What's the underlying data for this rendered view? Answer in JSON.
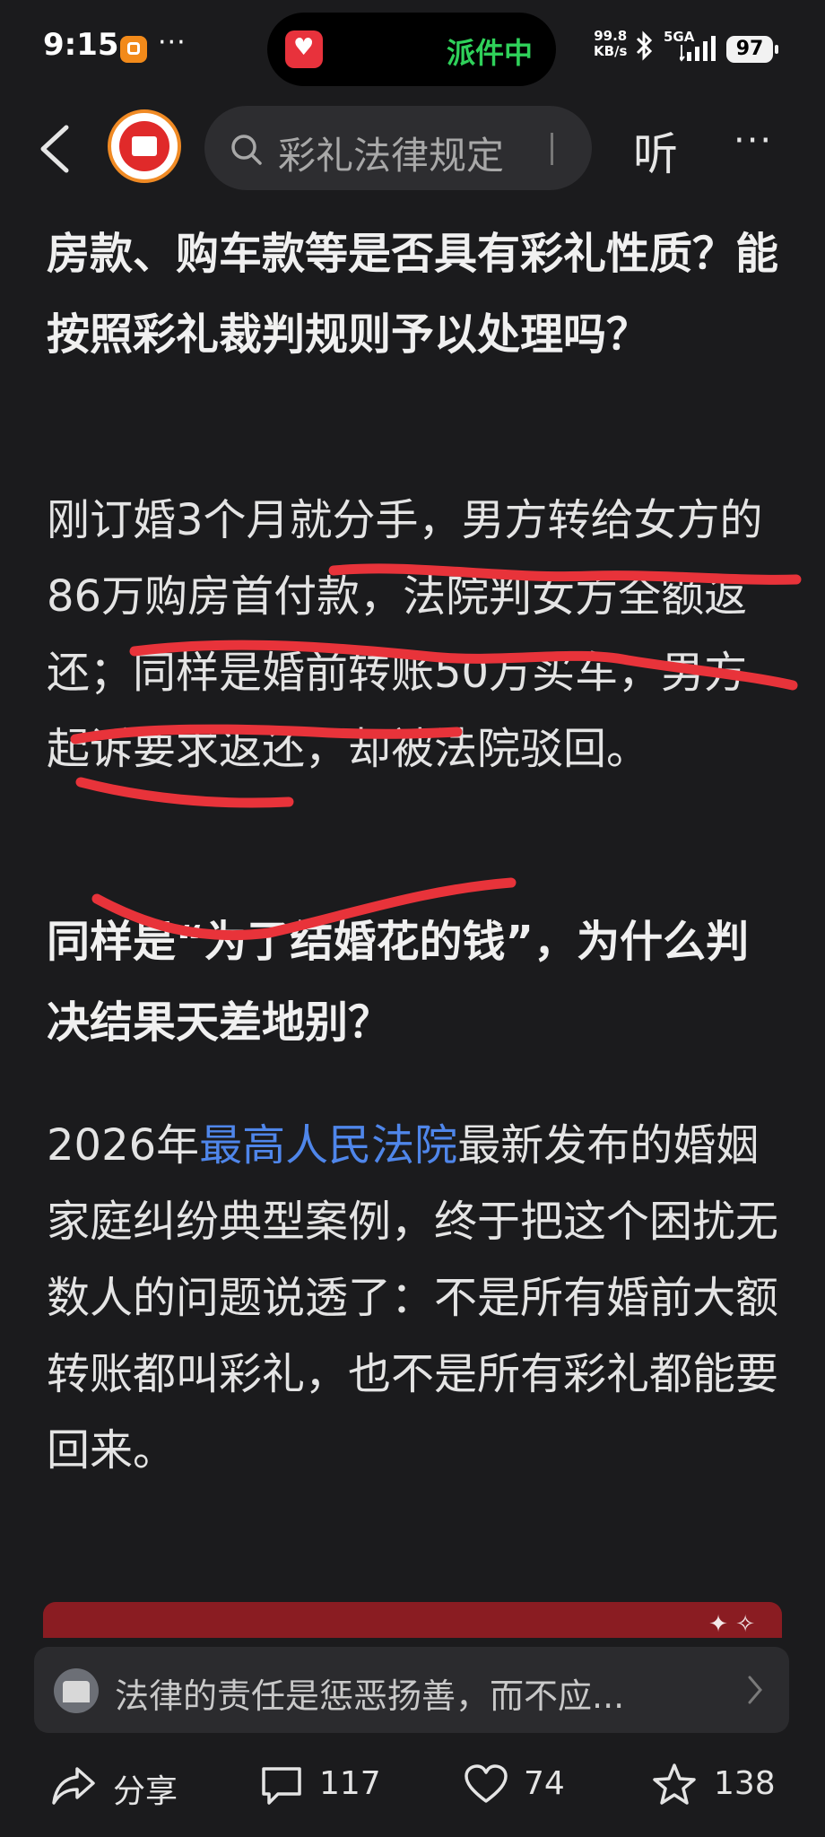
{
  "status_bar": {
    "time": "9:15",
    "dots": "···",
    "island_text": "派件中",
    "net_speed_top": "99.8",
    "net_speed_bottom": "KB/s",
    "signal": "5GA",
    "battery": "97"
  },
  "nav": {
    "search_text": "彩礼法律规定",
    "listen_label": "听",
    "more_label": "···"
  },
  "article": {
    "heading1": "房款、购车款等是否具有彩礼性质？能按照彩礼裁判规则予以处理吗？",
    "paragraph1": "刚订婚3个月就分手，男方转给女方的86万购房首付款，法院判女方全额返还；同样是婚前转账50万买车，男方起诉要求返还，却被法院驳回。",
    "heading2": "同样是“为了结婚花的钱”，为什么判决结果天差地别？",
    "paragraph2_prefix": "2026年",
    "paragraph2_link": "最高人民法院",
    "paragraph2_suffix": "最新发布的婚姻家庭纠纷典型案例，终于把这个困扰无数人的问题说透了：不是所有婚前大额转账都叫彩礼，也不是所有彩礼都能要回来。"
  },
  "comment_banner": {
    "text": "法律的责任是惩恶扬善，而不应..."
  },
  "actions": {
    "share_label": "分享",
    "comment_count": "117",
    "like_count": "74",
    "star_count": "138"
  },
  "colors": {
    "background": "#1b1b1d",
    "link": "#4f86ea",
    "annotation_red": "#e8333a",
    "island_green": "#2fd15a"
  }
}
